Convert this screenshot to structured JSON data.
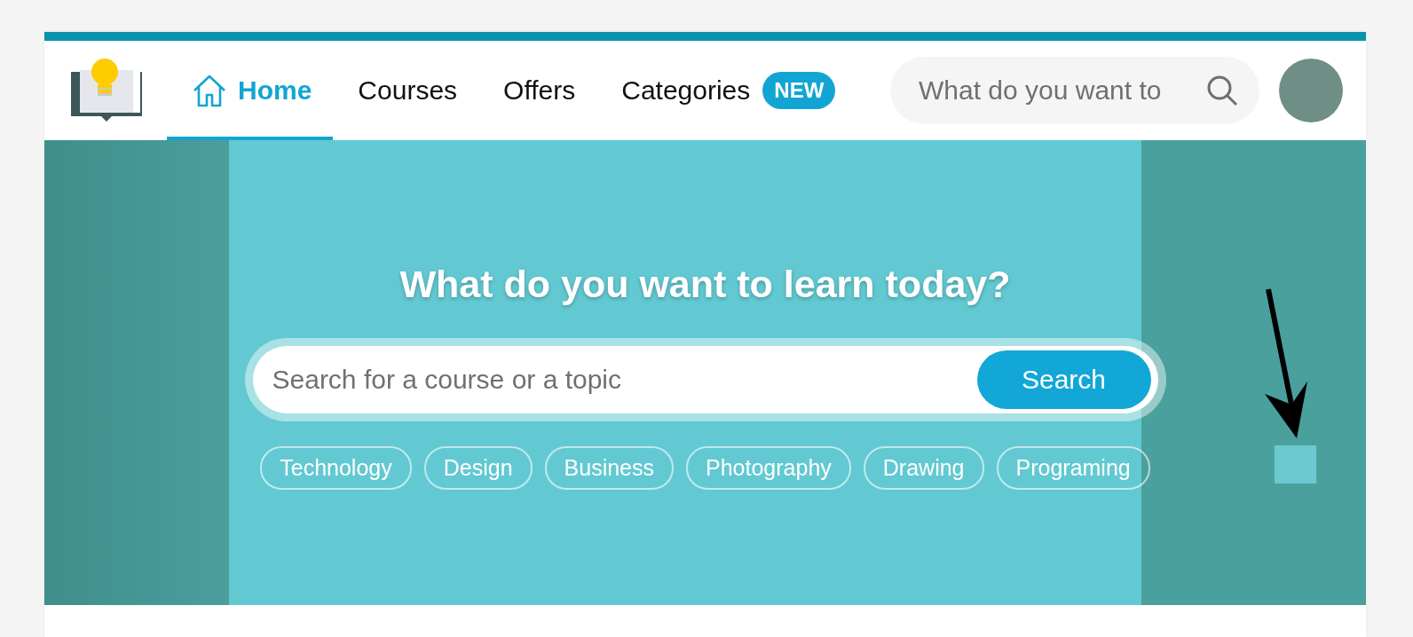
{
  "nav": {
    "items": [
      {
        "label": "Home",
        "selected": true,
        "kind": "home"
      },
      {
        "label": "Courses",
        "selected": false,
        "kind": "plain"
      },
      {
        "label": "Offers",
        "selected": false,
        "kind": "plain"
      },
      {
        "label": "Categories",
        "selected": false,
        "kind": "plain",
        "badge": "NEW"
      }
    ],
    "search": {
      "placeholder": "What do you want to"
    }
  },
  "hero": {
    "title": "What do you want to learn today?",
    "search": {
      "placeholder": "Search for a course or a topic",
      "button": "Search"
    },
    "chips": [
      "Technology",
      "Design",
      "Business",
      "Photography",
      "Drawing",
      "Programing"
    ]
  }
}
